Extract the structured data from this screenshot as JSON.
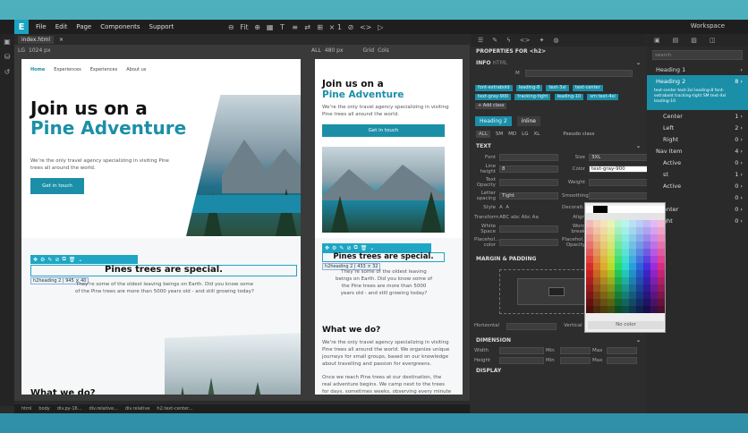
{
  "app": {
    "logo": "E",
    "menu": [
      "File",
      "Edit",
      "Page",
      "Components",
      "Support"
    ],
    "workspace": "Workspace",
    "toolbar_fit": "Fit",
    "toolbar_x1": "× 1"
  },
  "tabs": {
    "file": "index.html",
    "close": "×",
    "left_view": "LG",
    "left_width": "1024 px",
    "right_view": "ALL",
    "right_width": "480 px",
    "grid": "Grid",
    "cols": "Cols"
  },
  "site": {
    "nav": [
      "Home",
      "Experiences",
      "Experiences",
      "About us"
    ],
    "hero_title_1": "Join us on a",
    "hero_title_2": "Pine Adventure",
    "hero_text": "We’re the only travel agency specializing in visiting Pine trees all around the world.",
    "hero_button": "Get in touch",
    "special_heading": "Pines trees are special.",
    "special_text": "They’re some of the oldest leaving beings on Earth. Did you know some of the Pine trees are more than 5000 years old - and still growing today?",
    "what_title": "What we do?",
    "what_text": "We’re the only travel agency specializing in visiting Pine trees all around the world. We organize unique journeys for small groups, based on our knowledge about travelling and passion for evergreens.",
    "what_text2": "Once we reach Pine trees at our destination, the real adventure begins. We camp next to the trees for days, sometimes weeks, observing every minute details of their exciting lives. In return we gain insights into their long history, daily life and habits - and into our own lives.",
    "sel_tag_left": "h2heading 2 | 945 × 40",
    "sel_tag_right": "h2heading 2 | 433 × 32"
  },
  "status_path": [
    "html",
    "body",
    "div.py-16...",
    "div.relative...",
    "div.relative",
    "h2.text-center..."
  ],
  "props": {
    "title": "PROPERTIES FOR <h2>",
    "info": "INFO",
    "info_html": "HTML",
    "id_label": "M",
    "chips": [
      "font-extrabold",
      "leading-8",
      "text-3xl",
      "text-center",
      "text-gray-900",
      "tracking-tight",
      "leading-10",
      "sm:text-4xl",
      "+ Add class"
    ],
    "class_sel": "Heading 2",
    "class_inline": "inline",
    "breakpoints": [
      "ALL",
      "SM",
      "MD",
      "LG",
      "XL"
    ],
    "pseudo": "Pseudo class",
    "text_section": "TEXT",
    "font": "Font",
    "size": "Size",
    "size_val": "3XL",
    "line_height": "Line height",
    "line_val": "8",
    "color": "Color",
    "color_val": "text-gray-900",
    "text_opacity": "Text Opacity",
    "weight": "Weight",
    "letter_spacing": "Letter spacing",
    "spacing_val": "Tight",
    "smoothing": "Smoothing",
    "style": "Style",
    "decoration": "Decorati...",
    "transform": "Transform",
    "transform_vals": "ABC abc Abc Aa",
    "align": "Align",
    "white_space": "White Space",
    "word_break": "Word break",
    "placeholder": "Placehol... color",
    "placeholder_opacity": "Placehol... Opacity",
    "no_color": "No color",
    "margin_padding": "MARGIN & PADDING",
    "horizontal": "Horizontal",
    "vertical": "Vertical",
    "dimension": "DIMENSION",
    "width": "Width",
    "height": "Height",
    "min": "Min",
    "max": "Max",
    "display": "DISPLAY"
  },
  "navtree": {
    "search_placeholder": "search",
    "items": [
      {
        "label": "Heading 1",
        "count": "",
        "depth": 0
      },
      {
        "label": "Heading 2",
        "count": "8",
        "depth": 0,
        "selected": true
      },
      {
        "label": "Center",
        "count": "1",
        "depth": 1
      },
      {
        "label": "Left",
        "count": "2",
        "depth": 1
      },
      {
        "label": "Right",
        "count": "0",
        "depth": 1
      },
      {
        "label": "Nav Item",
        "count": "4",
        "depth": 0
      },
      {
        "label": "Active",
        "count": "0",
        "depth": 1
      },
      {
        "label": "st",
        "count": "1",
        "depth": 1
      },
      {
        "label": "Active",
        "count": "0",
        "depth": 1
      },
      {
        "label": "",
        "count": "0",
        "depth": 1
      },
      {
        "label": "enter",
        "count": "0",
        "depth": 1
      },
      {
        "label": "ght",
        "count": "0",
        "depth": 1
      }
    ],
    "badge_text": "text-center text-3xl leading-8 font-extrabold tracking-tight SM text-4xl leading-10"
  }
}
